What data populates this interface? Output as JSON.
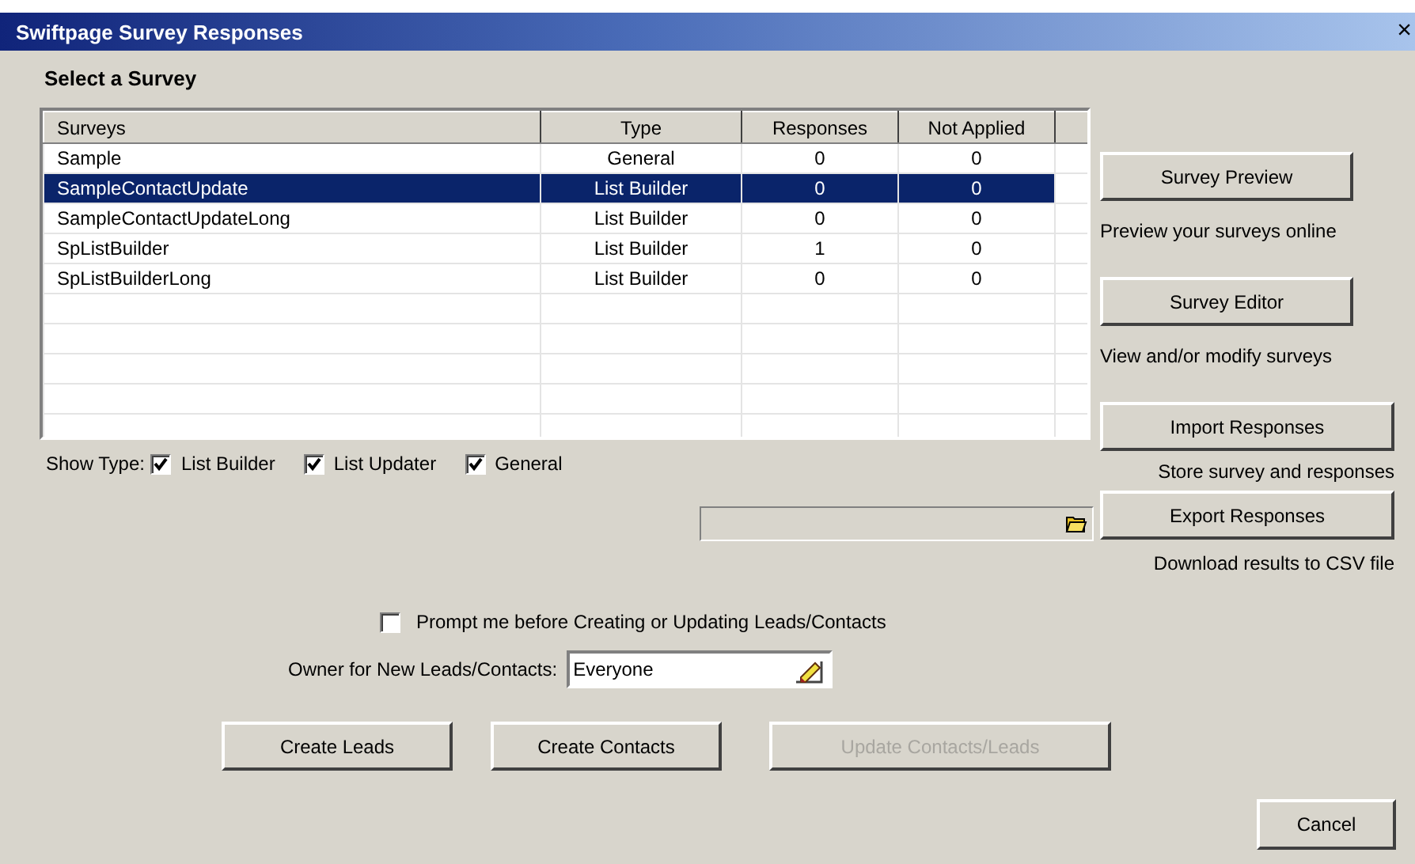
{
  "window": {
    "title": "Swiftpage Survey Responses",
    "close": "×"
  },
  "section_title": "Select a Survey",
  "table": {
    "columns": [
      "Surveys",
      "Type",
      "Responses",
      "Not Applied"
    ],
    "rows": [
      {
        "cells": [
          "Sample",
          "General",
          "0",
          "0"
        ],
        "selected": false
      },
      {
        "cells": [
          "SampleContactUpdate",
          "List Builder",
          "0",
          "0"
        ],
        "selected": true
      },
      {
        "cells": [
          "SampleContactUpdateLong",
          "List Builder",
          "0",
          "0"
        ],
        "selected": false
      },
      {
        "cells": [
          "SpListBuilder",
          "List Builder",
          "1",
          "0"
        ],
        "selected": false
      },
      {
        "cells": [
          "SpListBuilderLong",
          "List Builder",
          "0",
          "0"
        ],
        "selected": false
      }
    ]
  },
  "show_type": {
    "label": "Show Type:",
    "options": [
      {
        "label": "List Builder",
        "checked": true
      },
      {
        "label": "List Updater",
        "checked": true
      },
      {
        "label": "General",
        "checked": true
      }
    ]
  },
  "actions": [
    {
      "label": "Survey Preview",
      "hint": "Preview your surveys online"
    },
    {
      "label": "Survey Editor",
      "hint": "View and/or modify surveys"
    },
    {
      "label": "Import Responses",
      "hint": "Store survey and responses"
    },
    {
      "label": "Export Responses",
      "hint": "Download results to CSV file"
    }
  ],
  "prompt": {
    "label": "Prompt me before Creating or Updating Leads/Contacts",
    "checked": false
  },
  "owner": {
    "label": "Owner for New Leads/Contacts:",
    "value": "Everyone"
  },
  "buttons": [
    {
      "label": "Create Leads",
      "disabled": false
    },
    {
      "label": "Create Contacts",
      "disabled": false
    },
    {
      "label": "Update Contacts/Leads",
      "disabled": true
    }
  ],
  "cancel": "Cancel"
}
